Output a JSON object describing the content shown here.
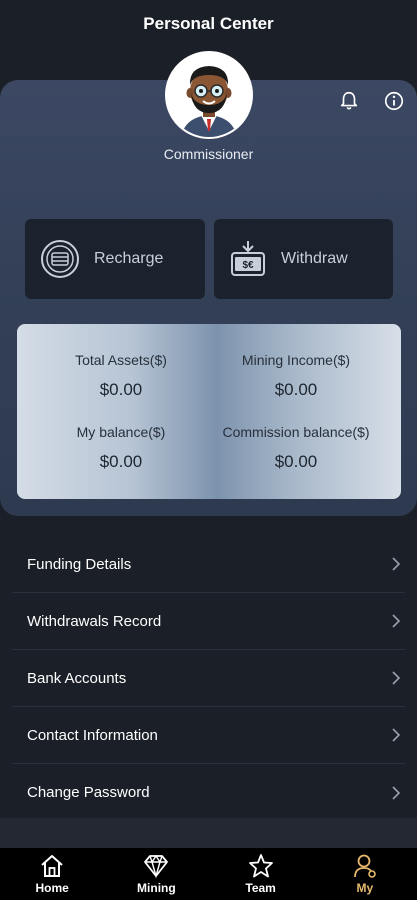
{
  "header": {
    "title": "Personal Center"
  },
  "profile": {
    "username": "Commissioner"
  },
  "icons": {
    "bell": "bell-icon",
    "info": "info-icon",
    "recharge": "coin-icon",
    "withdraw": "wallet-icon",
    "chevron": "chevron-right-icon"
  },
  "actions": {
    "recharge_label": "Recharge",
    "withdraw_label": "Withdraw"
  },
  "assets": {
    "total_assets_label": "Total Assets($)",
    "total_assets_value": "$0.00",
    "mining_income_label": "Mining Income($)",
    "mining_income_value": "$0.00",
    "my_balance_label": "My balance($)",
    "my_balance_value": "$0.00",
    "commission_balance_label": "Commission balance($)",
    "commission_balance_value": "$0.00"
  },
  "menu": {
    "items": [
      {
        "label": "Funding Details"
      },
      {
        "label": "Withdrawals Record"
      },
      {
        "label": "Bank Accounts"
      },
      {
        "label": "Contact Information"
      },
      {
        "label": "Change Password"
      }
    ]
  },
  "tabbar": {
    "items": [
      {
        "label": "Home"
      },
      {
        "label": "Mining"
      },
      {
        "label": "Team"
      },
      {
        "label": "My"
      }
    ],
    "active_color": "#e6b96e"
  },
  "colors": {
    "background": "#1b1f27",
    "card": "#334057",
    "action_bg": "#1c222d"
  }
}
